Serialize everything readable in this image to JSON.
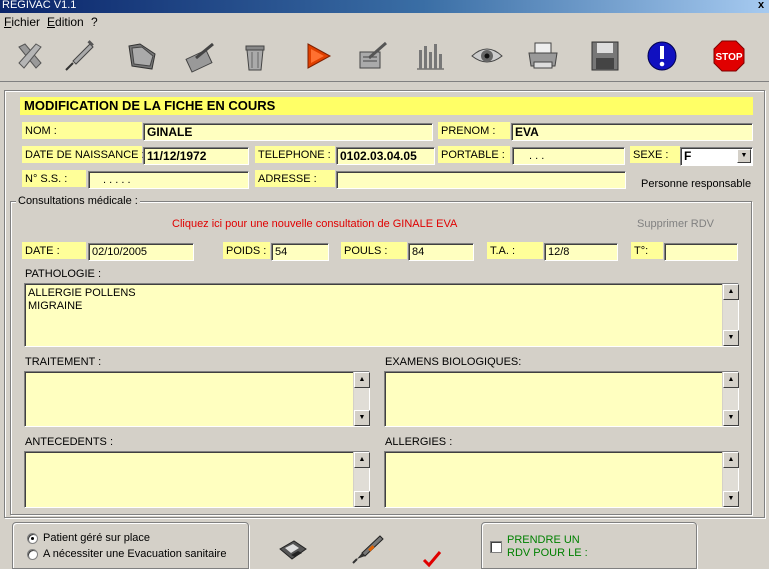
{
  "window": {
    "title": "REGIVAC V1.1",
    "close_glyph": "x"
  },
  "menu": [
    "Fichier",
    "Edition",
    "?"
  ],
  "toolbar": [
    "delete-icon",
    "syringe-icon",
    "folder-icon",
    "pen-icon",
    "trash-icon",
    "play-icon",
    "edit-list-icon",
    "chart-icon",
    "eye-icon",
    "printer-icon",
    "save-disk-icon",
    "info-icon",
    "stop-icon"
  ],
  "stop_label": "STOP",
  "form": {
    "header": "MODIFICATION DE LA FICHE EN COURS",
    "nom_label": "NOM :",
    "nom": "GINALE",
    "prenom_label": "PRENOM :",
    "prenom": "EVA",
    "dob_label": "DATE DE NAISSANCE :",
    "dob": "11/12/1972",
    "tel_label": "TELEPHONE :",
    "tel": "0102.03.04.05",
    "portable_label": "PORTABLE :",
    "portable": ". . .",
    "sexe_label": "SEXE :",
    "sexe": "F",
    "ss_label": "N° S.S. :",
    "ss": ". . . . .",
    "adresse_label": "ADRESSE :",
    "adresse": "",
    "responsable": "Personne responsable"
  },
  "consult": {
    "group_title": "Consultations médicale :",
    "new_link": "Cliquez ici pour une nouvelle consultation de GINALE EVA",
    "delete_rdv": "Supprimer RDV",
    "date_label": "DATE :",
    "date": "02/10/2005",
    "poids_label": "POIDS :",
    "poids": "54",
    "pouls_label": "POULS :",
    "pouls": "84",
    "ta_label": "T.A. :",
    "ta": "12/8",
    "temp_label": "T°:",
    "temp": "",
    "pathologie_label": "PATHOLOGIE :",
    "pathologie": "ALLERGIE POLLENS\nMIGRAINE",
    "traitement_label": "TRAITEMENT :",
    "traitement": "",
    "examens_label": "EXAMENS BIOLOGIQUES:",
    "examens": "",
    "antecedents_label": "ANTECEDENTS :",
    "antecedents": "",
    "allergies_label": "ALLERGIES :",
    "allergies": ""
  },
  "bottom": {
    "radio1": "Patient géré sur place",
    "radio2": "A nécessiter une Evacuation sanitaire",
    "rdv_line1": "PRENDRE UN",
    "rdv_line2": "RDV POUR LE :"
  },
  "colors": {
    "field_bg": "#ffffc0",
    "label_bg": "#ffff99",
    "header_bg": "#ffff66",
    "link_red": "#e00000",
    "green": "#008000"
  }
}
